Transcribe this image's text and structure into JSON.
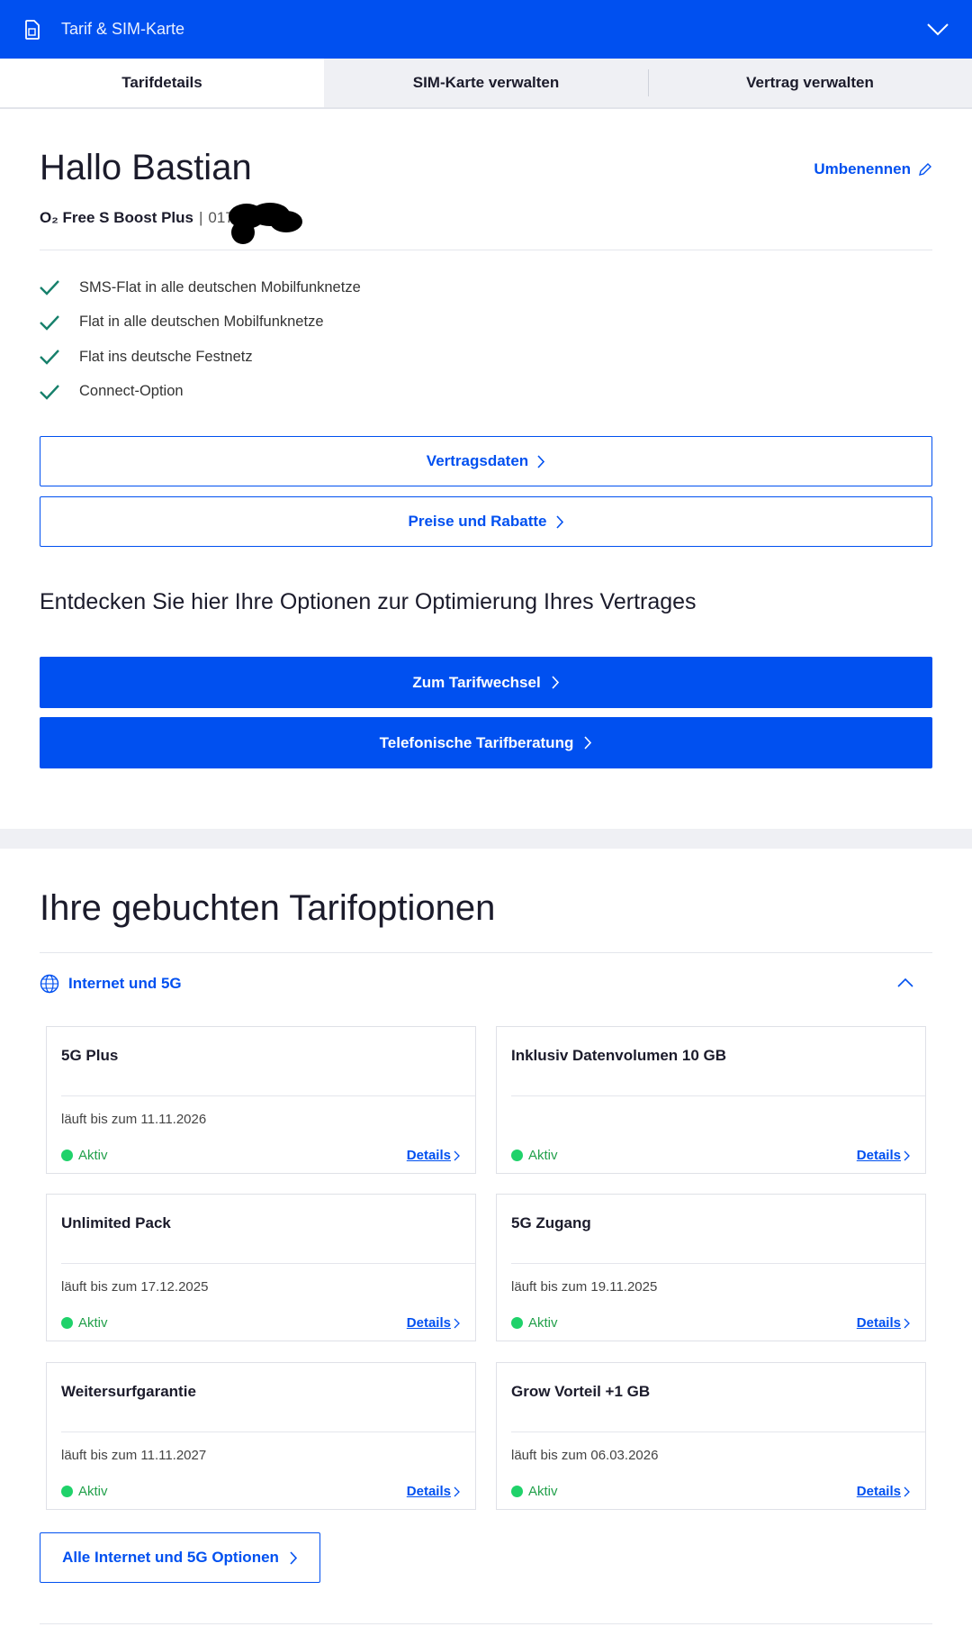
{
  "header": {
    "title": "Tarif & SIM-Karte",
    "icon": "sim-card-icon",
    "brand_color": "#0050f0"
  },
  "tabs": [
    {
      "label": "Tarifdetails",
      "active": true
    },
    {
      "label": "SIM-Karte verwalten",
      "active": false
    },
    {
      "label": "Vertrag verwalten",
      "active": false
    }
  ],
  "profile": {
    "greeting": "Hallo Bastian",
    "rename_label": "Umbenennen",
    "plan_name": "O₂ Free S Boost Plus",
    "separator": "|",
    "phone_prefix": "0179"
  },
  "features": [
    "SMS-Flat in alle deutschen Mobilfunknetze",
    "Flat in alle deutschen Mobilfunknetze",
    "Flat ins deutsche Festnetz",
    "Connect-Option"
  ],
  "buttons": {
    "contract_data": "Vertragsdaten",
    "prices": "Preise und Rabatte",
    "tariff_change": "Zum Tarifwechsel",
    "phone_consult": "Telefonische Tarifberatung"
  },
  "discover_text": "Entdecken Sie hier Ihre Optionen zur Optimierung Ihres Vertrages",
  "options": {
    "section_title": "Ihre gebuchten Tarifoptionen",
    "accordion_label": "Internet und 5G",
    "status_color": "#1fd26a",
    "cards": [
      {
        "title": "5G Plus",
        "until": "läuft bis zum 11.11.2026",
        "status": "Aktiv",
        "details": "Details"
      },
      {
        "title": "Inklusiv Datenvolumen 10 GB",
        "until": "",
        "status": "Aktiv",
        "details": "Details"
      },
      {
        "title": "Unlimited Pack",
        "until": "läuft bis zum 17.12.2025",
        "status": "Aktiv",
        "details": "Details"
      },
      {
        "title": "5G Zugang",
        "until": "läuft bis zum 19.11.2025",
        "status": "Aktiv",
        "details": "Details"
      },
      {
        "title": "Weitersurfgarantie",
        "until": "läuft bis zum 11.11.2027",
        "status": "Aktiv",
        "details": "Details"
      },
      {
        "title": "Grow Vorteil +1 GB",
        "until": "läuft bis zum 06.03.2026",
        "status": "Aktiv",
        "details": "Details"
      }
    ],
    "all_options_label": "Alle Internet und 5G Optionen"
  }
}
